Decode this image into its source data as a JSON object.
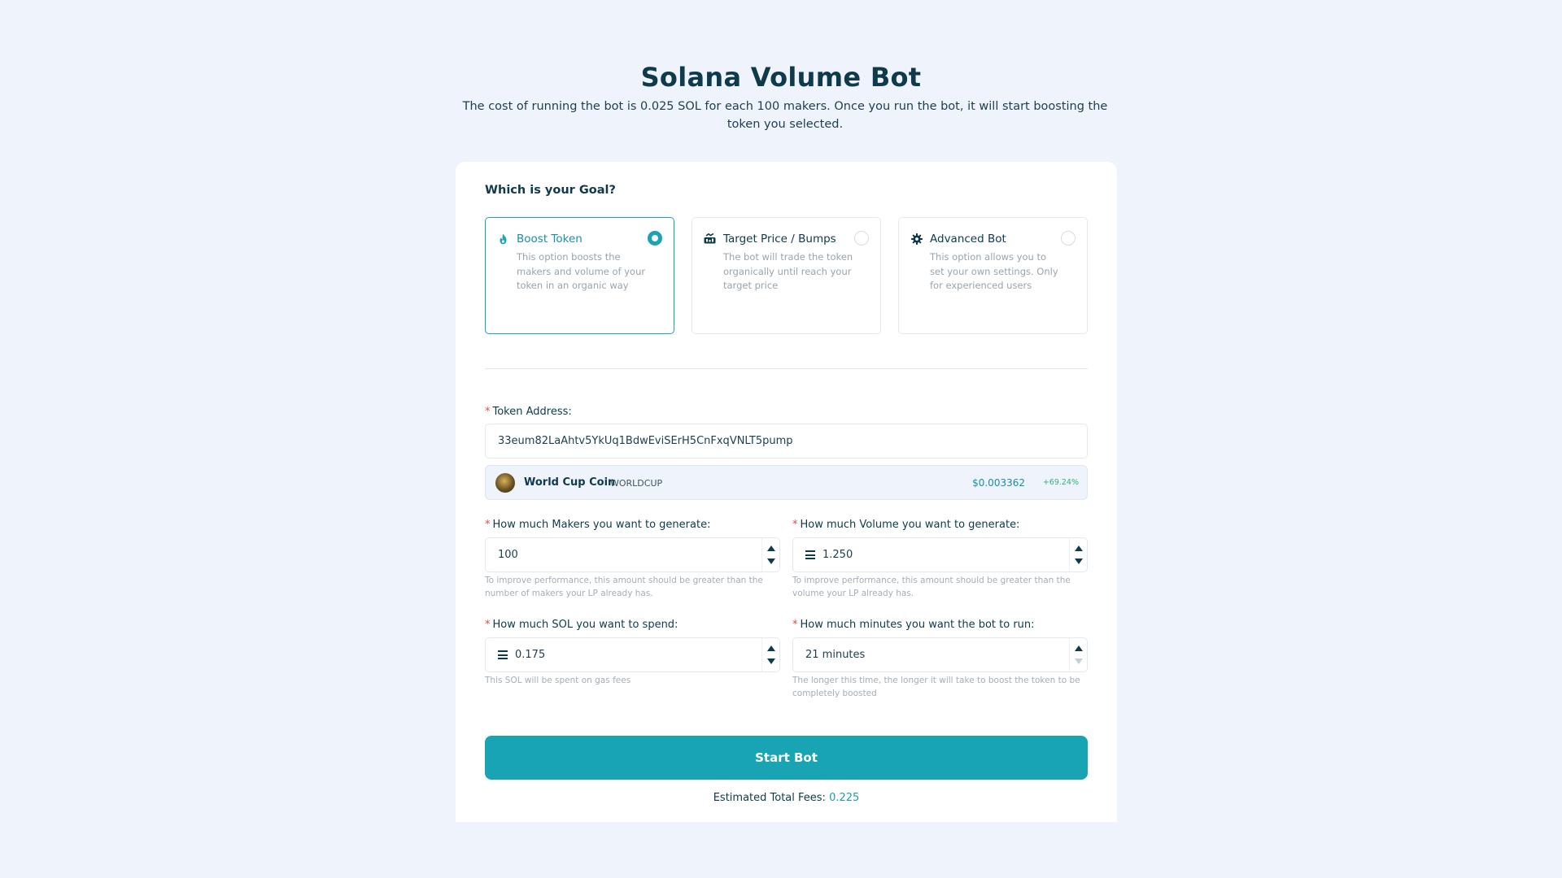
{
  "header": {
    "title": "Solana Volume Bot",
    "subtitle": "The cost of running the bot is 0.025 SOL for each 100 makers. Once you run the bot, it will start boosting the token you selected."
  },
  "goal": {
    "heading": "Which is your Goal?",
    "options": [
      {
        "title": "Boost Token",
        "description": "This option boosts the makers and volume of your token in an organic way",
        "icon": "flame-icon",
        "selected": true
      },
      {
        "title": "Target Price / Bumps",
        "description": "The bot will trade the token organically until reach your target price",
        "icon": "chart-bump-icon",
        "selected": false
      },
      {
        "title": "Advanced Bot",
        "description": "This option allows you to set your own settings. Only for experienced users",
        "icon": "gear-icon",
        "selected": false
      }
    ]
  },
  "token_address": {
    "label": "Token Address:",
    "value": "33eum82LaAhtv5YkUq1BdwEviSErH5CnFxqVNLT5pump"
  },
  "token_info": {
    "name": "World Cup Coin",
    "symbol": "WORLDCUP",
    "price": "$0.003362",
    "change": "+69.24%"
  },
  "makers": {
    "label": "How much Makers you want to generate:",
    "value": "100",
    "help": "To improve performance, this amount should be greater than the number of makers your LP already has."
  },
  "volume": {
    "label": "How much Volume you want to generate:",
    "value": "1.250",
    "help": "To improve performance, this amount should be greater than the volume your LP already has."
  },
  "sol_spend": {
    "label": "How much SOL you want to spend:",
    "value": "0.175",
    "help": "This SOL will be spent on gas fees"
  },
  "minutes": {
    "label": "How much minutes you want the bot to run:",
    "value": "21 minutes",
    "help": "The longer this time, the longer it will take to boost the token to be completely boosted"
  },
  "actions": {
    "start_label": "Start Bot"
  },
  "fees": {
    "label": "Estimated Total Fees:",
    "amount": "0.225"
  },
  "colors": {
    "accent": "#19a4b4",
    "background": "#eef3fc",
    "required": "#e5484d",
    "positive": "#33b27a"
  }
}
